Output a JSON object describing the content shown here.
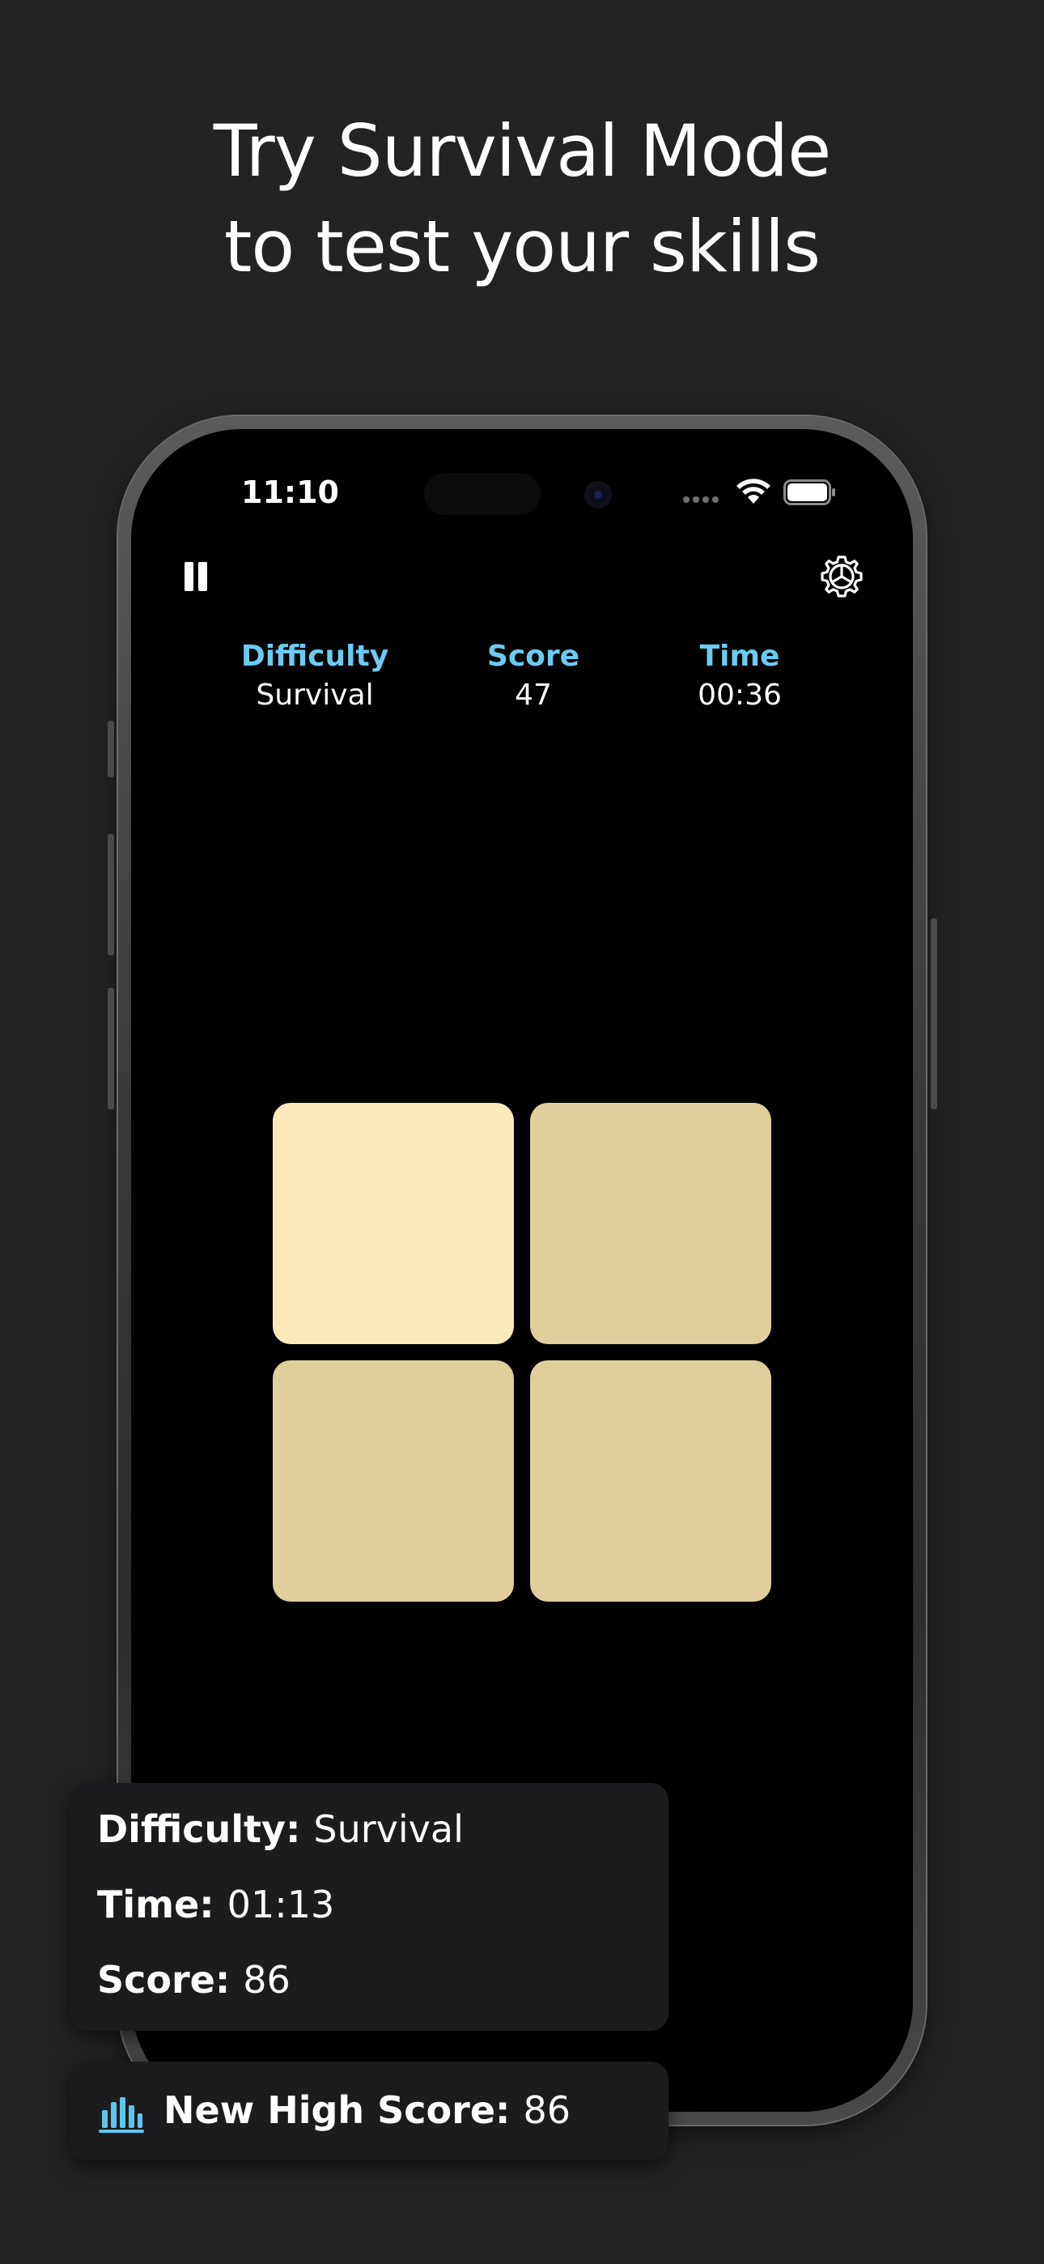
{
  "headline": {
    "line1": "Try Survival Mode",
    "line2": "to test your skills"
  },
  "status_bar": {
    "time": "11:10"
  },
  "toolbar": {
    "pause_icon": "pause-icon",
    "settings_icon": "gear-icon"
  },
  "stats": [
    {
      "label": "Difficulty",
      "value": "Survival"
    },
    {
      "label": "Score",
      "value": "47"
    },
    {
      "label": "Time",
      "value": "00:36"
    }
  ],
  "tiles": [
    {
      "color": "#f9e9b9"
    },
    {
      "color": "#dfcf9c"
    },
    {
      "color": "#dfcf9c"
    },
    {
      "color": "#dfcf9c"
    }
  ],
  "result_card": {
    "difficulty_label": "Difficulty:",
    "difficulty_value": "Survival",
    "time_label": "Time:",
    "time_value": "01:13",
    "score_label": "Score:",
    "score_value": "86"
  },
  "high_score_card": {
    "icon": "bar-chart-icon",
    "label": "New High Score:",
    "value": "86"
  },
  "colors": {
    "accent": "#6ccbf2",
    "background": "#232323",
    "card": "#1c1c1e"
  }
}
